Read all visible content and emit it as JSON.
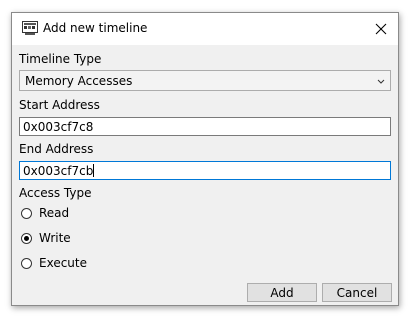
{
  "window": {
    "title": "Add new timeline",
    "icon": "timeline-app-icon",
    "close_icon": "close-icon"
  },
  "form": {
    "timeline_type": {
      "label": "Timeline Type",
      "selected": "Memory Accesses",
      "icon": "chevron-down-icon"
    },
    "start_address": {
      "label": "Start Address",
      "value": "0x003cf7c8"
    },
    "end_address": {
      "label": "End Address",
      "value": "0x003cf7cb"
    },
    "access_type": {
      "label": "Access Type",
      "options": [
        {
          "label": "Read",
          "selected": false
        },
        {
          "label": "Write",
          "selected": true
        },
        {
          "label": "Execute",
          "selected": false
        }
      ]
    }
  },
  "buttons": {
    "add_label": "Add",
    "cancel_label": "Cancel"
  },
  "colors": {
    "dialog_bg": "#f0f0f0",
    "focus_border": "#0078d7"
  }
}
